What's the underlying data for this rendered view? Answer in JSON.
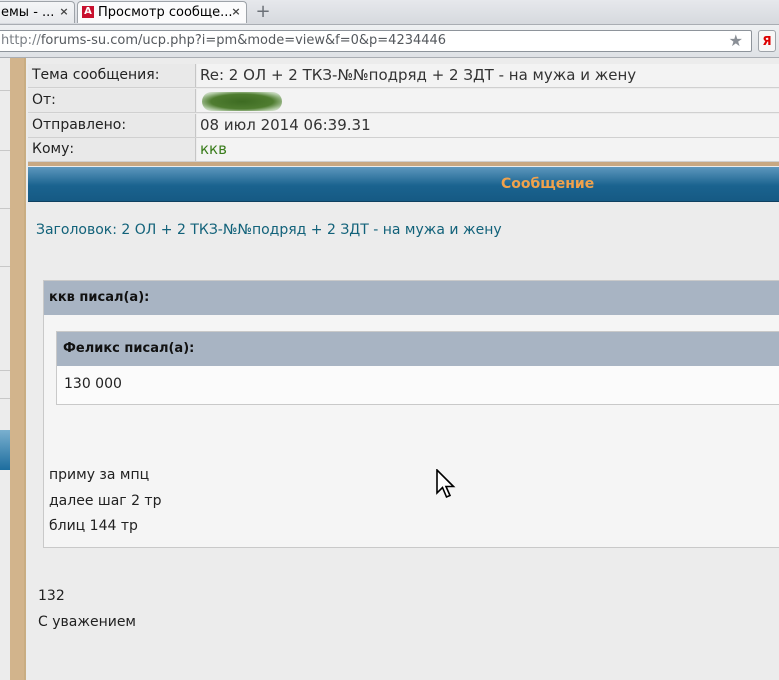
{
  "browser": {
    "tabs": [
      {
        "label": "емы - ...",
        "close": "×"
      },
      {
        "label": "Просмотр сообще...",
        "favicon": "А",
        "close": "×"
      }
    ],
    "new_tab": "+",
    "url_scheme": "http://",
    "url_rest": "forums-su.com/ucp.php?i=pm&mode=view&f=0&p=4234446",
    "bookmark_star": "★",
    "yandex_button": "Я"
  },
  "message_header": {
    "subject_label": "Тема сообщения:",
    "subject_value": "Re: 2 ОЛ + 2 ТКЗ-№№подряд + 2 ЗДТ - на мужа и жену",
    "from_label": "От:",
    "sent_label": "Отправлено:",
    "sent_value": "08 июл 2014 06:39.31",
    "to_label": "Кому:",
    "to_value": "ккв"
  },
  "message_section": {
    "title": "Сообщение",
    "subject_line": "Заголовок: 2 ОЛ + 2 ТКЗ-№№подряд + 2 ЗДТ - на мужа и жену"
  },
  "quote": {
    "author_line": "ккв писал(а):",
    "inner_author_line": "Феликс писал(а):",
    "inner_text": "130 000",
    "lines": [
      "приму за мпц",
      "далее шаг 2 тр",
      "блиц 144 тр"
    ]
  },
  "body": {
    "lines": [
      "132",
      "С уважением"
    ]
  },
  "colors": {
    "accent_orange": "#f0a24c",
    "header_blue": "#1a638f",
    "link_teal": "#12627a",
    "recipient_green": "#3a7d1c"
  },
  "icons": {
    "cursor": "mouse-pointer-icon",
    "star": "bookmark-star-icon"
  }
}
